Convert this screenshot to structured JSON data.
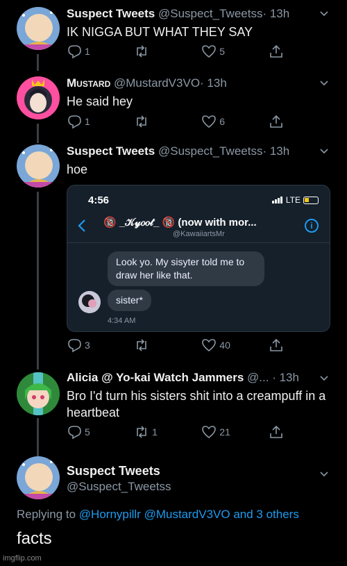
{
  "tweets": [
    {
      "name": "Suspect Tweets",
      "handle": "@Suspect_Tweetss",
      "time": "· 13h",
      "text": "IK NIGGA BUT WHAT THEY SAY",
      "replies": "1",
      "retweets": "",
      "likes": "5"
    },
    {
      "name": "Mustard",
      "handle": "@MustardV3VO",
      "time": "· 13h",
      "text": "He said hey",
      "replies": "1",
      "retweets": "",
      "likes": "6"
    },
    {
      "name": "Suspect Tweets",
      "handle": "@Suspect_Tweetss",
      "time": "· 13h",
      "text": "hoe",
      "replies": "3",
      "retweets": "",
      "likes": "40"
    },
    {
      "name": "Alicia @ Yo-kai Watch Jammers",
      "handle": "@...",
      "time": "· 13h",
      "text": "Bro I'd turn his sisters shit into a creampuff in a heartbeat",
      "replies": "5",
      "retweets": "1",
      "likes": "21"
    }
  ],
  "embed": {
    "time": "4:56",
    "network": "LTE",
    "chat_title": "🔞 _𝒦𝓎𝑜𝑜𝓉_ 🔞 (now with mor...",
    "chat_handle": "@KawaiiartsMr",
    "message1": "Look yo. My sisyter told me to draw her like that.",
    "message2": "sister*",
    "message_time": "4:34 AM"
  },
  "final_tweet": {
    "name": "Suspect Tweets",
    "handle": "@Suspect_Tweetss",
    "replying_prefix": "Replying to",
    "replying_to": "@Hornypillr @MustardV3VO and 3 others",
    "text": "facts"
  },
  "watermark": "imgflip.com",
  "colors": {
    "background": "#000000",
    "accent": "#1d9bf0",
    "muted": "#8b98a5"
  }
}
